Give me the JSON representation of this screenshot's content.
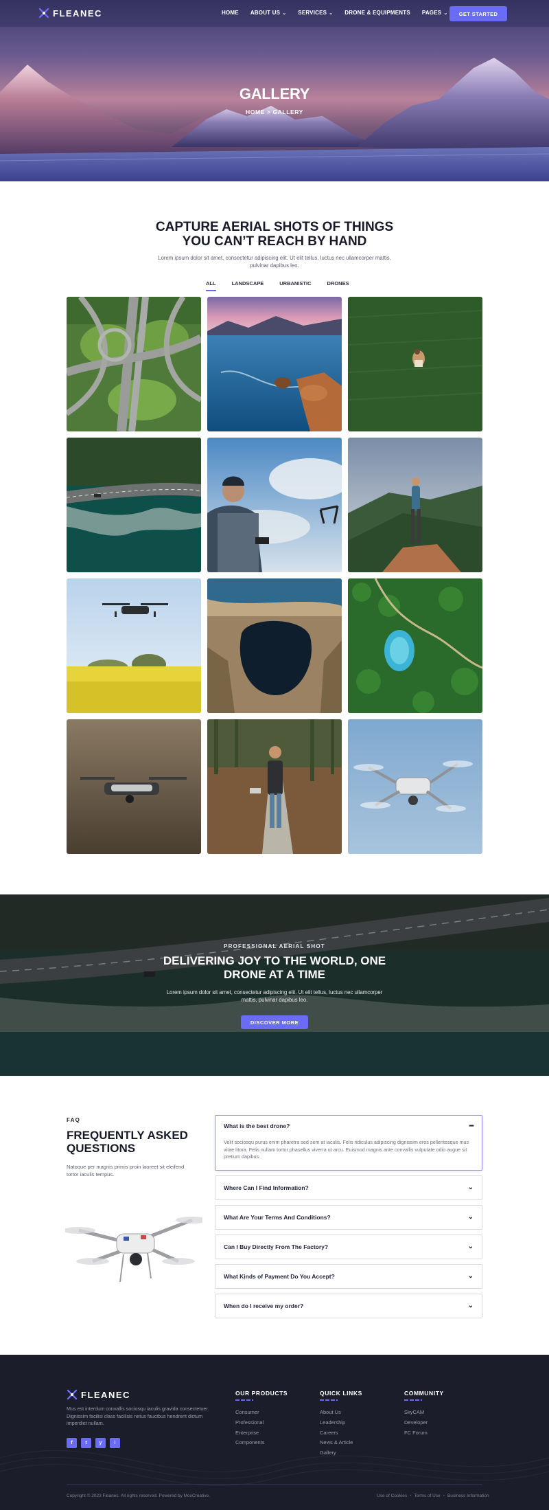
{
  "header": {
    "logo_text": "FLEANEC",
    "nav": [
      {
        "label": "HOME",
        "has_dropdown": false
      },
      {
        "label": "ABOUT US",
        "has_dropdown": true
      },
      {
        "label": "SERVICES",
        "has_dropdown": true
      },
      {
        "label": "DRONE & EQUIPMENTS",
        "has_dropdown": false
      },
      {
        "label": "PAGES",
        "has_dropdown": true
      }
    ],
    "cta_label": "GET STARTED"
  },
  "hero": {
    "title": "GALLERY",
    "breadcrumb_home": "HOME",
    "breadcrumb_sep": ">",
    "breadcrumb_current": "GALLERY"
  },
  "gallery": {
    "title_line1": "CAPTURE AERIAL SHOTS OF THINGS",
    "title_line2": "YOU CAN’T REACH BY HAND",
    "description": "Lorem ipsum dolor sit amet, consectetur adipiscing elit. Ut elit tellus, luctus nec ullamcorper mattis, pulvinar dapibus leo.",
    "tabs": [
      "ALL",
      "LANDSCAPE",
      "URBANISTIC",
      "DRONES"
    ],
    "active_tab": "ALL",
    "images": [
      "highway-interchange-image",
      "coastal-bay-image",
      "field-person-image",
      "coastal-road-image",
      "drone-pilot-image",
      "hiker-mountain-image",
      "drone-rapeseed-image",
      "cave-lake-image",
      "forest-lake-image",
      "hovering-drone-image",
      "man-boardwalk-image",
      "sky-drone-image"
    ]
  },
  "banner": {
    "eyebrow": "PROFESSIONAL AERIAL SHOT",
    "title_line1": "DELIVERING JOY TO THE WORLD, ONE",
    "title_line2": "DRONE AT A TIME",
    "description": "Lorem ipsum dolor sit amet, consectetur adipiscing elit. Ut elit tellus, luctus nec ullamcorper mattis, pulvinar dapibus leo.",
    "button_label": "DISCOVER MORE"
  },
  "faq": {
    "eyebrow": "FAQ",
    "title_line1": "FREQUENTLY ASKED",
    "title_line2": "QUESTIONS",
    "description": "Natoque per magnis primis proin laoreet sit eleifend tortor iaculis tempus.",
    "items": [
      {
        "question": "What is the best drone?",
        "answer": "Velit sociosqu purus enim pharetra sed sem at iaculis. Felis ridiculus adipiscing dignissim eros pellentesque mus vitae litora. Felis nullam tortor phasellus viverra ut arcu. Euismod magnis ante convallis vulputate odio augue sit pretium dapibus.",
        "open": true
      },
      {
        "question": "Where Can I Find Information?",
        "answer": "",
        "open": false
      },
      {
        "question": "What Are Your Terms And Conditions?",
        "answer": "",
        "open": false
      },
      {
        "question": "Can I Buy Directly From The Factory?",
        "answer": "",
        "open": false
      },
      {
        "question": "What Kinds of Payment Do You Accept?",
        "answer": "",
        "open": false
      },
      {
        "question": "When do I receive my order?",
        "answer": "",
        "open": false
      }
    ]
  },
  "footer": {
    "logo_text": "FLEANEC",
    "description": "Mus est interdum convallis sociosqu iaculis gravida consectetuer. Dignissim facilisi class facilisis netus faucibus hendrerit dictum imperdiet nullam.",
    "social": [
      "f",
      "t",
      "y",
      "i"
    ],
    "columns": [
      {
        "heading": "OUR PRODUCTS",
        "links": [
          "Consumer",
          "Professional",
          "Enterprise",
          "Components"
        ]
      },
      {
        "heading": "QUICK LINKS",
        "links": [
          "About Us",
          "Leadership",
          "Careers",
          "News & Article",
          "Gallery"
        ]
      },
      {
        "heading": "COMMUNITY",
        "links": [
          "SkyCAM",
          "Developer",
          "FC Forum"
        ]
      }
    ],
    "copyright": "Copyright © 2023 Fleanec. All rights reserved. Powered by MoxCreative.",
    "legal": [
      "Use of Cookies",
      "Terms of Use",
      "Business Information"
    ],
    "legal_sep": "•"
  },
  "colors": {
    "accent": "#6a6cf6",
    "dark": "#1c1d2b",
    "text": "#171a26"
  }
}
